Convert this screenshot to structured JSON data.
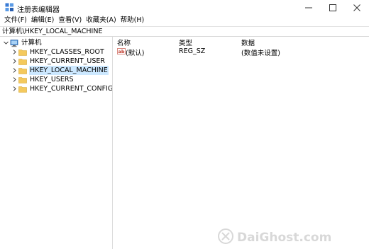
{
  "window": {
    "title": "注册表编辑器",
    "controls": {
      "minimize_icon": "minimize-icon",
      "maximize_icon": "maximize-icon",
      "close_icon": "close-icon"
    }
  },
  "menu": [
    {
      "label": "文件(F)"
    },
    {
      "label": "编辑(E)"
    },
    {
      "label": "查看(V)"
    },
    {
      "label": "收藏夹(A)"
    },
    {
      "label": "帮助(H)"
    }
  ],
  "address": {
    "path": "计算机\\HKEY_LOCAL_MACHINE"
  },
  "tree": {
    "root": {
      "label": "计算机",
      "icon": "computer-icon",
      "expanded": true
    },
    "children": [
      {
        "label": "HKEY_CLASSES_ROOT",
        "icon": "folder-icon",
        "selected": false
      },
      {
        "label": "HKEY_CURRENT_USER",
        "icon": "folder-icon",
        "selected": false
      },
      {
        "label": "HKEY_LOCAL_MACHINE",
        "icon": "folder-icon",
        "selected": true
      },
      {
        "label": "HKEY_USERS",
        "icon": "folder-icon",
        "selected": false
      },
      {
        "label": "HKEY_CURRENT_CONFIG",
        "icon": "folder-icon",
        "selected": false
      }
    ]
  },
  "list": {
    "columns": {
      "name": "名称",
      "type": "类型",
      "data": "数据"
    },
    "rows": [
      {
        "name": "(默认)",
        "type": "REG_SZ",
        "data": "(数值未设置)",
        "icon": "string-value-icon"
      }
    ]
  },
  "colors": {
    "selection": "#cce8ff",
    "folder": "#f4c95d",
    "icon_red": "#c0392b"
  }
}
